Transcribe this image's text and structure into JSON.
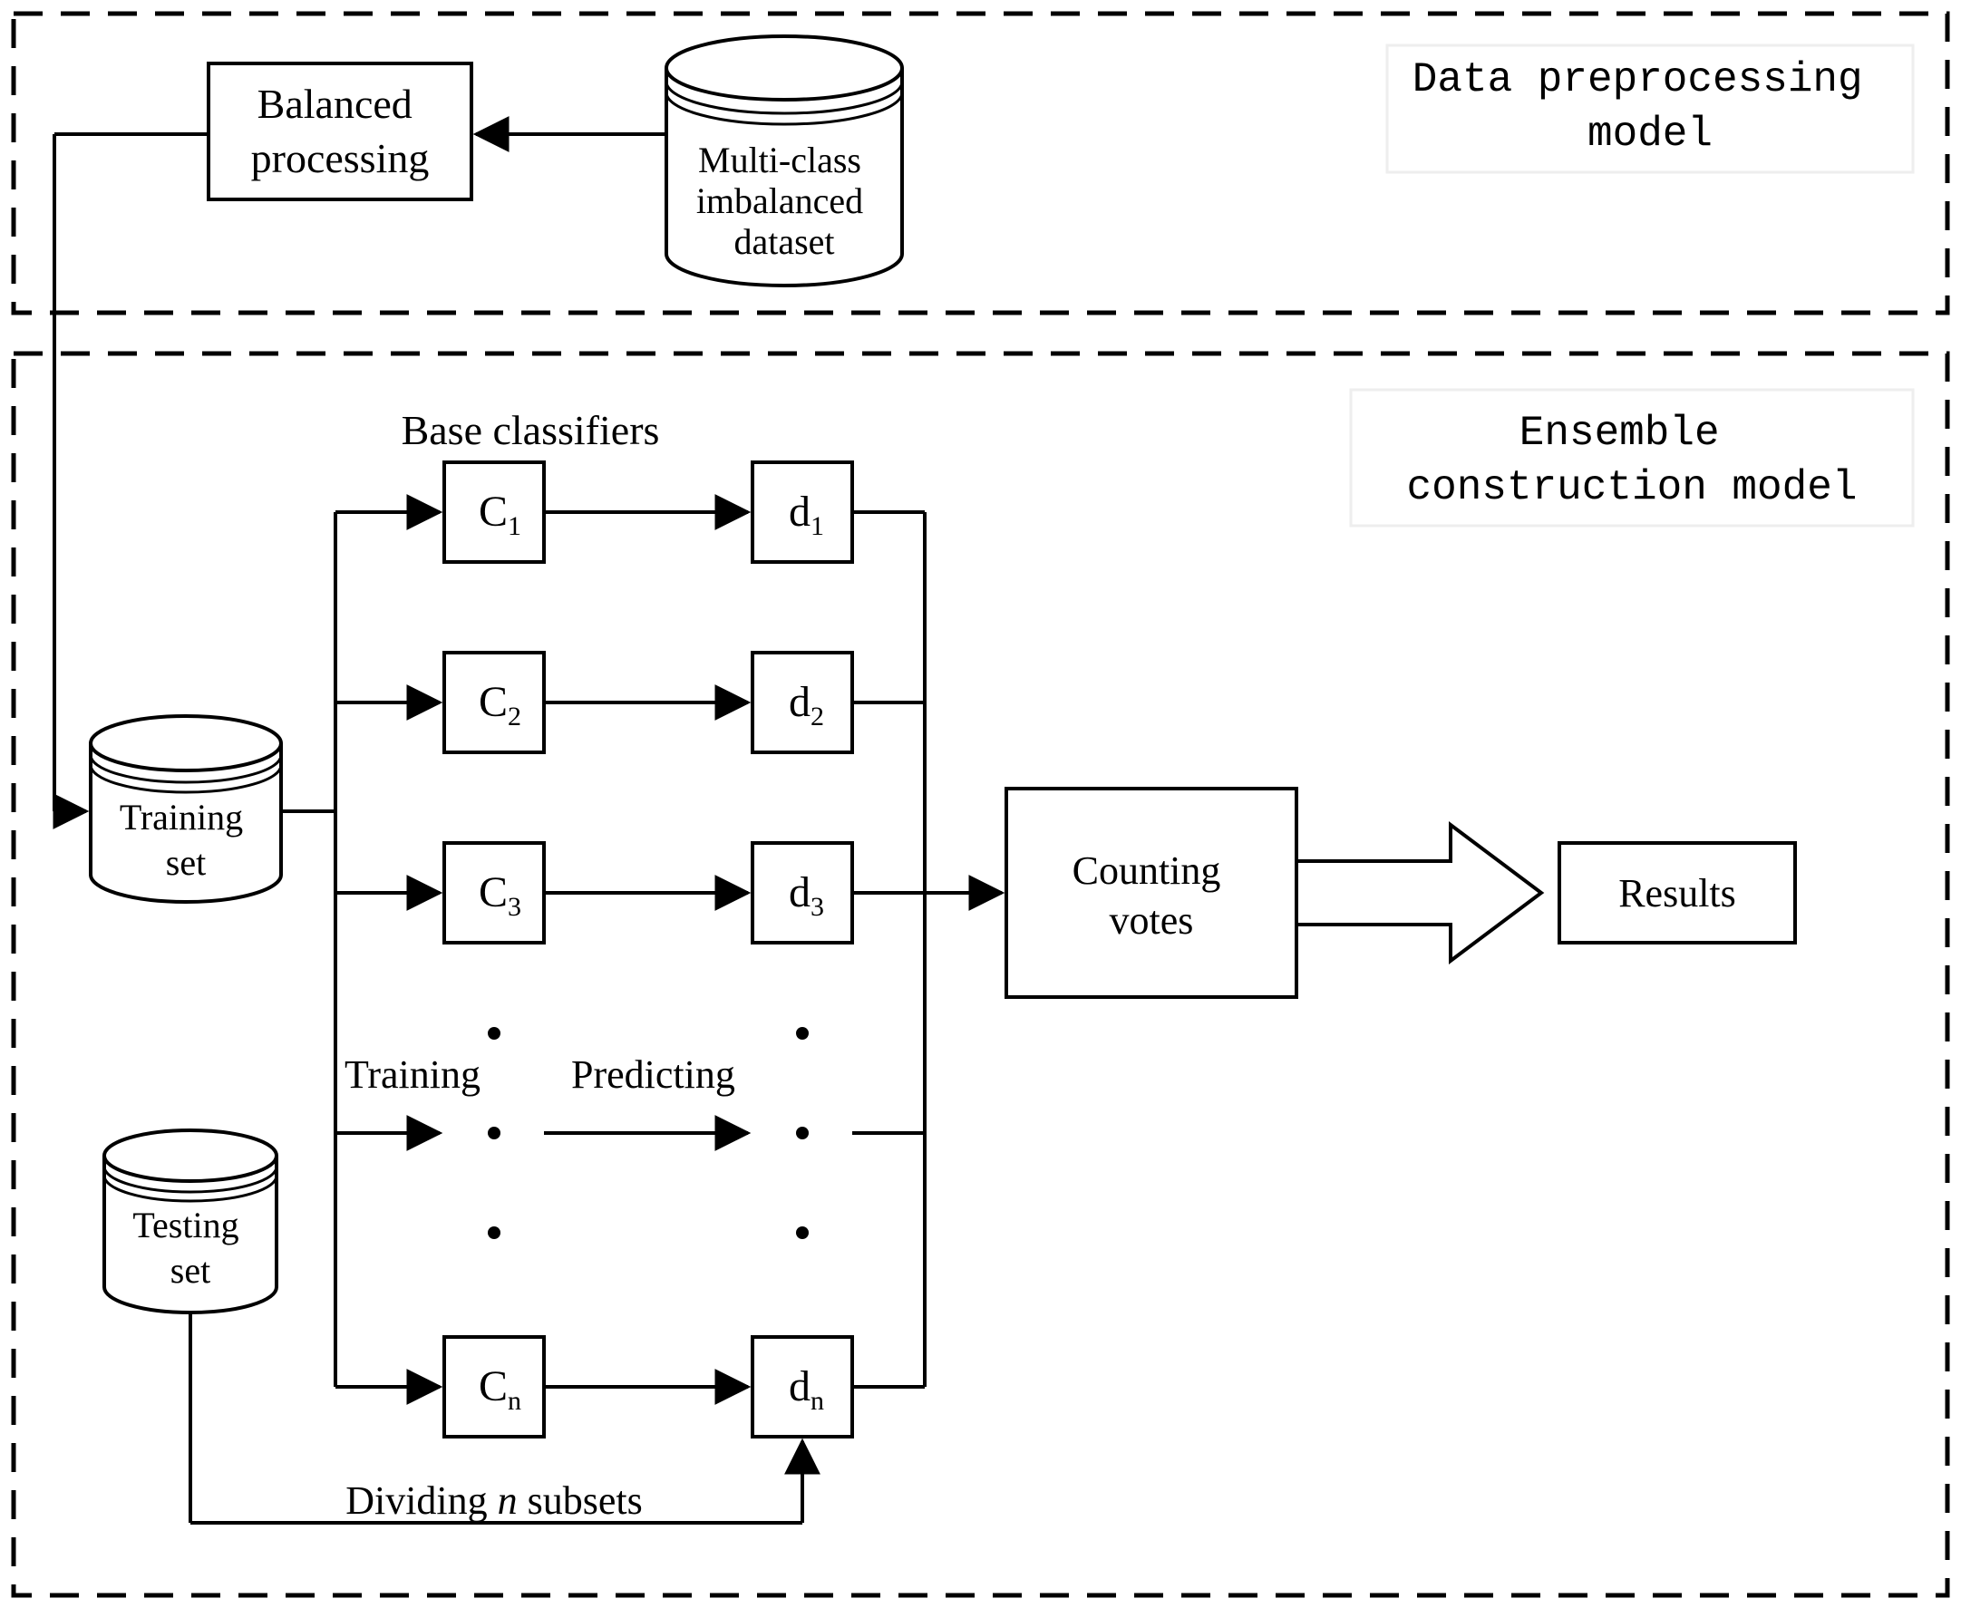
{
  "top": {
    "title": "Data preprocessing model",
    "balanced": "Balanced processing",
    "db": "Multi-class imbalanced dataset"
  },
  "bottom": {
    "title": "Ensemble construction model",
    "training": "Training set",
    "testing": "Testing set",
    "base_label": "Base classifiers",
    "classifiers": [
      "C",
      "C",
      "C",
      "C"
    ],
    "classifier_subs": [
      "1",
      "2",
      "3",
      "n"
    ],
    "decisions": [
      "d",
      "d",
      "d",
      "d"
    ],
    "decision_subs": [
      "1",
      "2",
      "3",
      "n"
    ],
    "training_label": "Training",
    "predicting_label": "Predicting",
    "dividing": "Dividing n subsets",
    "counting": "Counting votes",
    "results": "Results"
  }
}
